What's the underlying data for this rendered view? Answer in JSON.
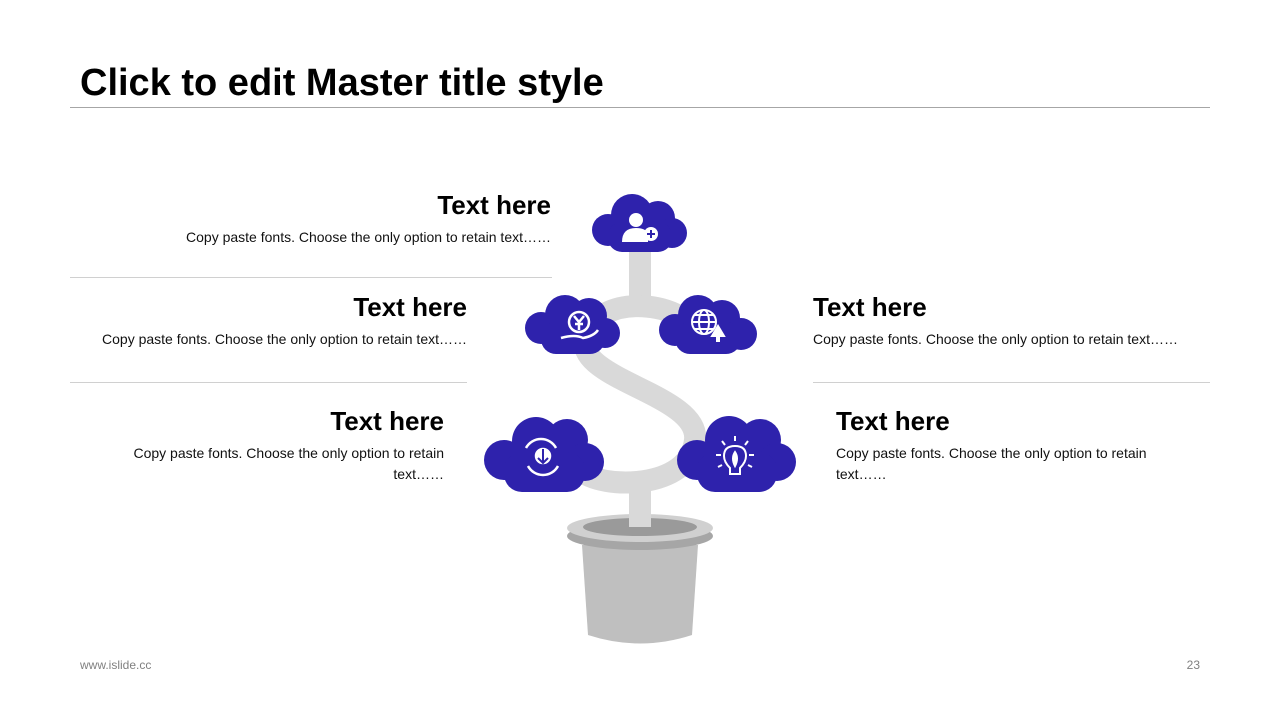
{
  "slide": {
    "title": "Click to edit Master title style",
    "footer_url": "www.islide.cc",
    "page_number": "23"
  },
  "blocks": [
    {
      "heading": "Text here",
      "body": "Copy paste fonts. Choose the only option to retain text……"
    },
    {
      "heading": "Text here",
      "body": "Copy paste fonts. Choose the only option to retain text……"
    },
    {
      "heading": "Text here",
      "body": "Copy paste fonts. Choose the only option to retain text……"
    },
    {
      "heading": "Text here",
      "body": "Copy paste fonts. Choose the only option to retain text……"
    },
    {
      "heading": "Text here",
      "body": "Copy paste fonts. Choose the only option to retain text……"
    }
  ],
  "colors": {
    "cloud": "#2e22ac",
    "stem": "#d9d9d9",
    "pot": "#bfbfbf"
  },
  "icons": [
    "add-user-icon",
    "yen-hand-icon",
    "globe-upload-icon",
    "gear-refresh-icon",
    "lightbulb-icon"
  ]
}
